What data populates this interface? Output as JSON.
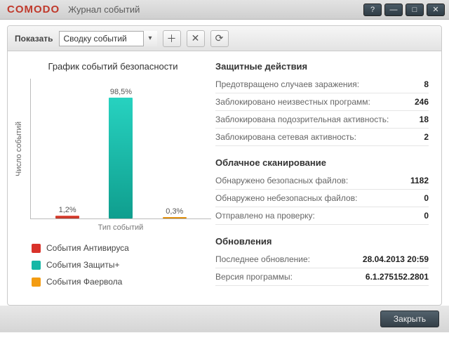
{
  "brand": "COMODO",
  "window_title": "Журнал событий",
  "toolbar": {
    "show_label": "Показать",
    "selected": "Сводку событий"
  },
  "chart": {
    "title": "График событий безопасности",
    "ylabel": "Число событий",
    "xlabel": "Тип событий"
  },
  "chart_data": {
    "type": "bar",
    "categories": [
      "События Антивируса",
      "События Защиты+",
      "События Фаервола"
    ],
    "values": [
      1.2,
      98.5,
      0.3
    ],
    "labels": [
      "1,2%",
      "98,5%",
      "0,3%"
    ],
    "colors": [
      "#d9322a",
      "#16b7a6",
      "#f39c12"
    ],
    "ylabel": "Число событий",
    "xlabel": "Тип событий",
    "title": "График событий безопасности",
    "ylim": [
      0,
      100
    ]
  },
  "legend": {
    "av": "События Антивируса",
    "def": "События Защиты+",
    "fw": "События Фаервола"
  },
  "sections": {
    "defense_head": "Защитные действия",
    "defense": [
      {
        "k": "Предотвращено случаев заражения:",
        "v": "8"
      },
      {
        "k": "Заблокировано неизвестных программ:",
        "v": "246"
      },
      {
        "k": "Заблокирована подозрительная активность:",
        "v": "18"
      },
      {
        "k": "Заблокирована сетевая активность:",
        "v": "2"
      }
    ],
    "cloud_head": "Облачное сканирование",
    "cloud": [
      {
        "k": "Обнаружено безопасных файлов:",
        "v": "1182"
      },
      {
        "k": "Обнаружено небезопасных файлов:",
        "v": "0"
      },
      {
        "k": "Отправлено на проверку:",
        "v": "0"
      }
    ],
    "updates_head": "Обновления",
    "updates": [
      {
        "k": "Последнее обновление:",
        "v": "28.04.2013 20:59"
      },
      {
        "k": "Версия программы:",
        "v": "6.1.275152.2801"
      }
    ]
  },
  "footer": {
    "close": "Закрыть"
  }
}
